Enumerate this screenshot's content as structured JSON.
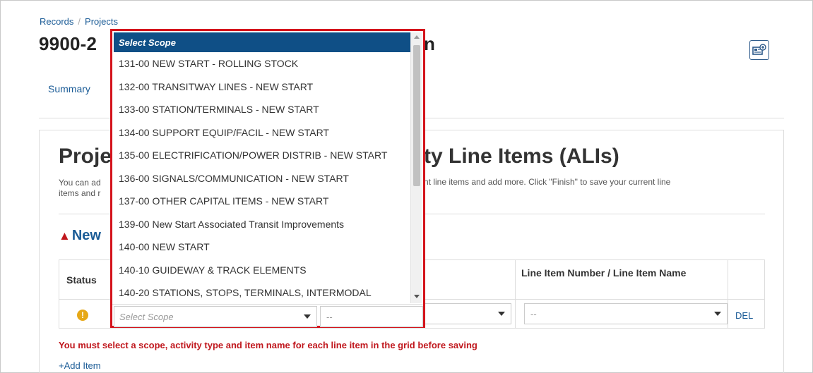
{
  "breadcrumb": {
    "records": "Records",
    "sep": "/",
    "projects": "Projects"
  },
  "page": {
    "title_visible": "9900-2",
    "title_tail": "n"
  },
  "tabs": {
    "summary": "Summary"
  },
  "section": {
    "title_visible": "Proje",
    "title_tail": "ty Line Items (ALIs)",
    "desc_line1": "You can ad",
    "desc_line2": "items and r",
    "desc_tail": "nt line items and add more. Click \"Finish\" to save your current line"
  },
  "new_section": {
    "heading": "New"
  },
  "grid": {
    "col_status": "Status",
    "col_line_item": "Line Item Number / Line Item Name",
    "row": {
      "status_icon": "!",
      "scope_placeholder": "Select Scope",
      "activity_value": "--",
      "line_item_value": "--",
      "del_label": "DEL"
    }
  },
  "error_message": "You must select a scope, activity type and item name for each line item in the grid before saving",
  "add_item_label": "+Add Item",
  "dropdown": {
    "selected": "Select Scope",
    "options": [
      "131-00 NEW START - ROLLING STOCK",
      "132-00 TRANSITWAY LINES - NEW START",
      "133-00 STATION/TERMINALS - NEW START",
      "134-00 SUPPORT EQUIP/FACIL - NEW START",
      "135-00 ELECTRIFICATION/POWER DISTRIB - NEW START",
      "136-00 SIGNALS/COMMUNICATION - NEW START",
      "137-00 OTHER CAPITAL ITEMS - NEW START",
      "139-00 New Start Associated Transit Improvements",
      "140-00 NEW START",
      "140-10 GUIDEWAY & TRACK ELEMENTS",
      "140-20 STATIONS, STOPS, TERMINALS, INTERMODAL"
    ],
    "scroll_position": 0.04
  },
  "colors": {
    "accent": "#1a5b96",
    "highlight_frame": "#d4141c",
    "selected_bg": "#0f4f86",
    "error": "#c0171d",
    "warning": "#e6a817"
  },
  "icons": {
    "export": "export-document-icon",
    "status": "warning-circle-icon",
    "section_alert": "warning-triangle-icon"
  }
}
